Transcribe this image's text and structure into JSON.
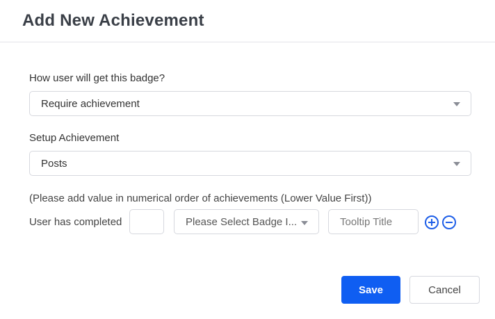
{
  "modal": {
    "title": "Add New Achievement"
  },
  "badge_method": {
    "label": "How user will get this badge?",
    "selected": "Require achievement"
  },
  "setup": {
    "label": "Setup Achievement",
    "selected": "Posts"
  },
  "achievement_row": {
    "note": "(Please add value in numerical order of achievements (Lower Value First))",
    "label": "User has completed",
    "count_value": "",
    "badge_select": "Please Select Badge I...",
    "tooltip_placeholder": "Tooltip Title"
  },
  "actions": {
    "save_label": "Save",
    "cancel_label": "Cancel"
  },
  "colors": {
    "primary": "#0f5ef2",
    "icon_blue": "#1d5ee8"
  },
  "icons": [
    "chevron-down-icon",
    "plus-circle-icon",
    "minus-circle-icon"
  ]
}
